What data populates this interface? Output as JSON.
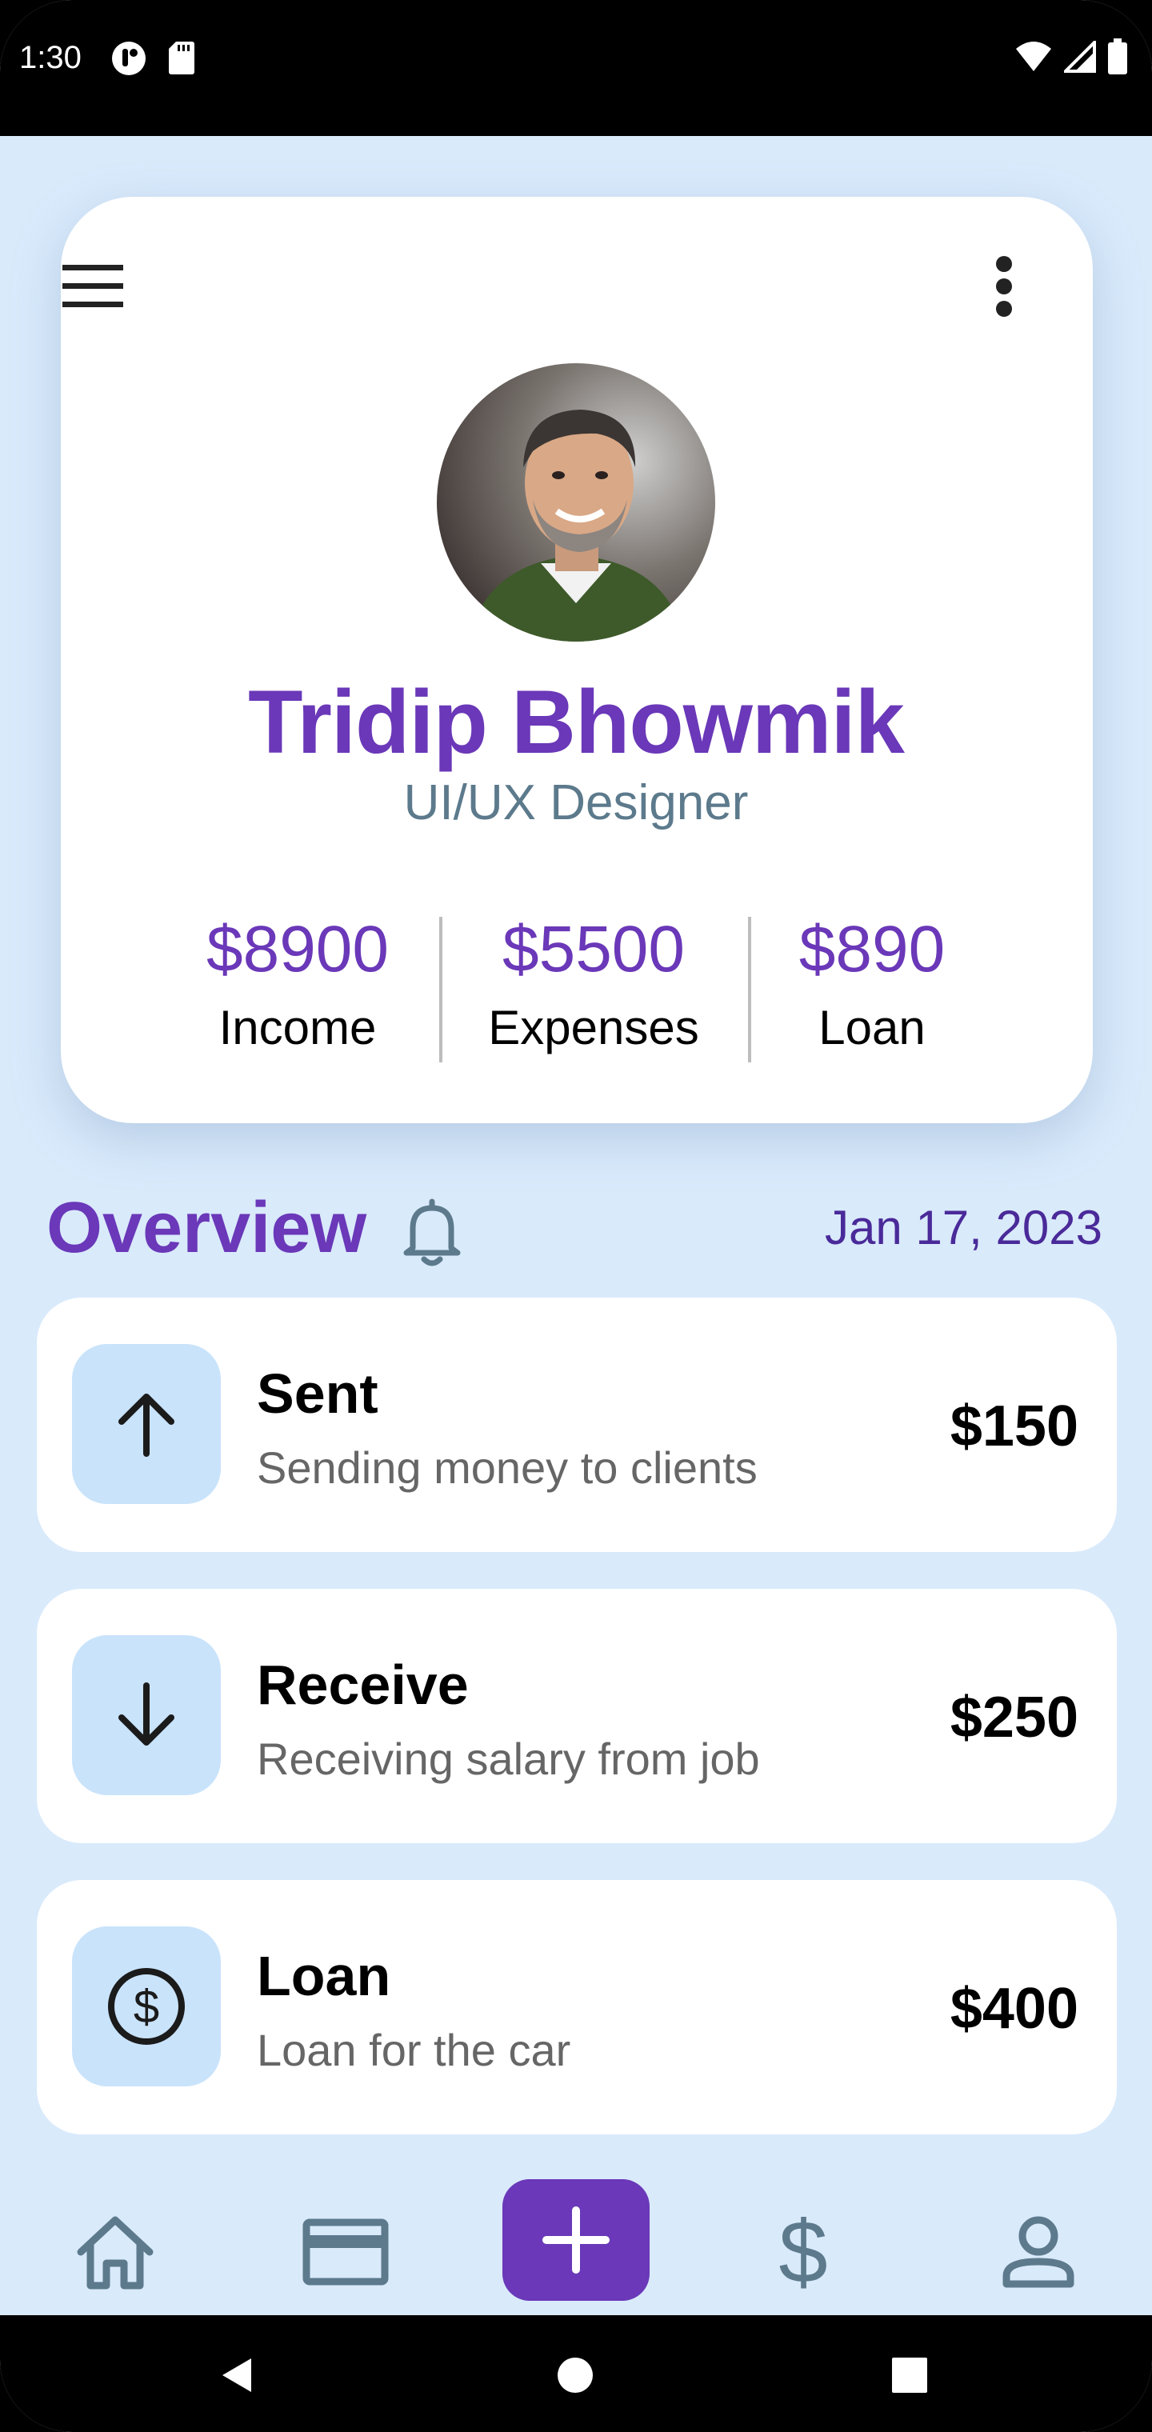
{
  "status_bar": {
    "time": "1:30",
    "icons_left": [
      "app-notification-icon",
      "sd-card-icon"
    ],
    "icons_right": [
      "wifi-icon",
      "cell-signal-icon",
      "battery-icon"
    ]
  },
  "profile": {
    "name": "Tridip Bhowmik",
    "role": "UI/UX Designer",
    "stats": [
      {
        "value": "$8900",
        "label": "Income"
      },
      {
        "value": "$5500",
        "label": "Expenses"
      },
      {
        "value": "$890",
        "label": "Loan"
      }
    ]
  },
  "overview": {
    "title": "Overview",
    "date": "Jan 17, 2023"
  },
  "transactions": [
    {
      "icon": "arrow-up-icon",
      "title": "Sent",
      "description": "Sending money to clients",
      "amount": "$150"
    },
    {
      "icon": "arrow-down-icon",
      "title": "Receive",
      "description": "Receiving salary from job",
      "amount": "$250"
    },
    {
      "icon": "dollar-circle-icon",
      "title": "Loan",
      "description": "Loan for the car",
      "amount": "$400"
    }
  ],
  "bottom_nav": [
    "home-icon",
    "card-icon",
    "add-icon",
    "dollar-icon",
    "profile-icon"
  ],
  "colors": {
    "accent": "#6a38b8",
    "background": "#d9eafb",
    "icon_box": "#c9e3fb",
    "muted_text": "#5c7a8c"
  }
}
